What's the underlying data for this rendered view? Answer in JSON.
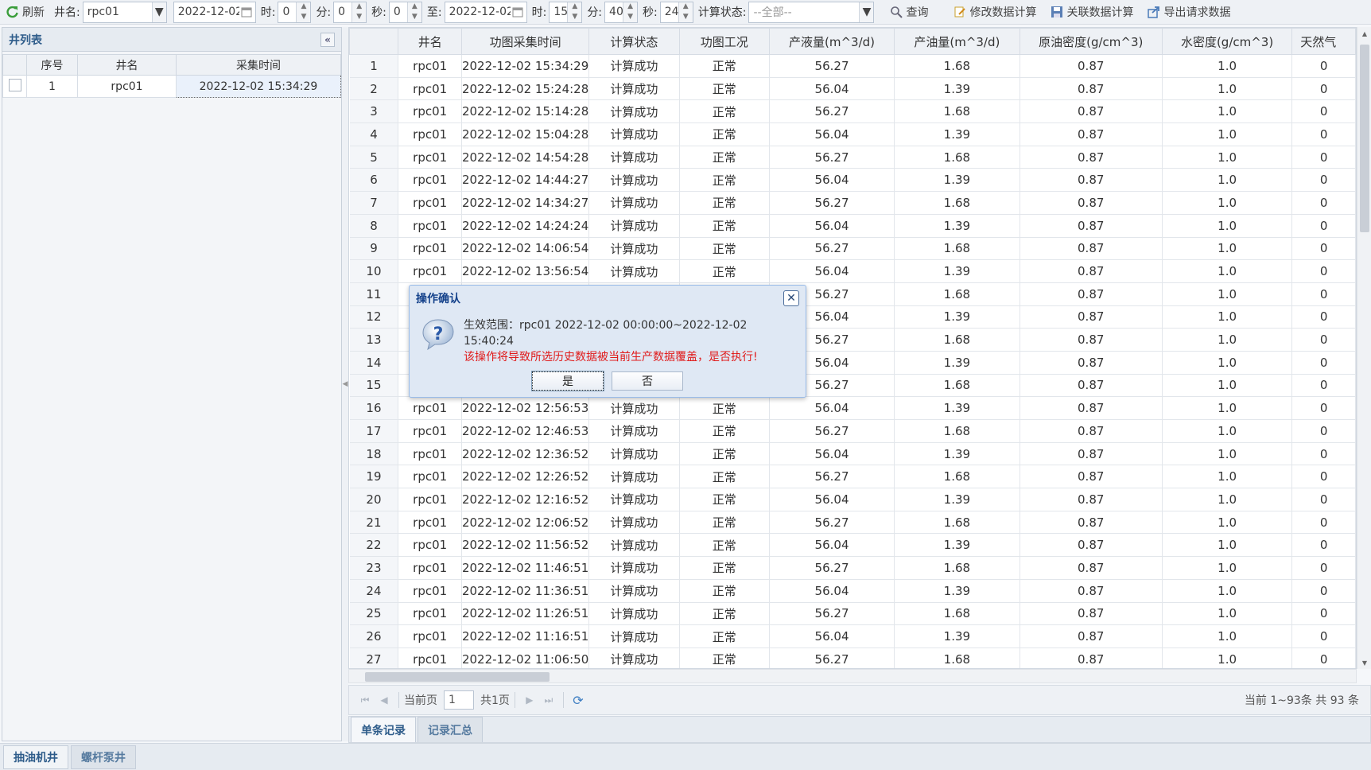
{
  "toolbar": {
    "refresh": "刷新",
    "well_label": "井名:",
    "well_value": "rpc01",
    "start_date": "2022-12-02",
    "hour_label": "时:",
    "hour_value": "0",
    "min_label": "分:",
    "min_value": "0",
    "sec_label": "秒:",
    "sec_value": "0",
    "to_label": "至:",
    "end_date": "2022-12-02",
    "end_hour_label": "时:",
    "end_hour_value": "15",
    "end_min_label": "分:",
    "end_min_value": "40",
    "end_sec_label": "秒:",
    "end_sec_value": "24",
    "status_label": "计算状态:",
    "status_value": "--全部--",
    "query": "查询",
    "modify_calc": "修改数据计算",
    "link_calc": "关联数据计算",
    "export": "导出请求数据"
  },
  "left_panel": {
    "title": "井列表",
    "columns": [
      "序号",
      "井名",
      "采集时间"
    ],
    "rows": [
      {
        "index": "1",
        "well": "rpc01",
        "time": "2022-12-02 15:34:29"
      }
    ]
  },
  "grid": {
    "columns": [
      "井名",
      "功图采集时间",
      "计算状态",
      "功图工况",
      "产液量(m^3/d)",
      "产油量(m^3/d)",
      "原油密度(g/cm^3)",
      "水密度(g/cm^3)",
      "天然气"
    ],
    "rows": [
      [
        "1",
        "rpc01",
        "2022-12-02 15:34:29",
        "计算成功",
        "正常",
        "56.27",
        "1.68",
        "0.87",
        "1.0",
        "0"
      ],
      [
        "2",
        "rpc01",
        "2022-12-02 15:24:28",
        "计算成功",
        "正常",
        "56.04",
        "1.39",
        "0.87",
        "1.0",
        "0"
      ],
      [
        "3",
        "rpc01",
        "2022-12-02 15:14:28",
        "计算成功",
        "正常",
        "56.27",
        "1.68",
        "0.87",
        "1.0",
        "0"
      ],
      [
        "4",
        "rpc01",
        "2022-12-02 15:04:28",
        "计算成功",
        "正常",
        "56.04",
        "1.39",
        "0.87",
        "1.0",
        "0"
      ],
      [
        "5",
        "rpc01",
        "2022-12-02 14:54:28",
        "计算成功",
        "正常",
        "56.27",
        "1.68",
        "0.87",
        "1.0",
        "0"
      ],
      [
        "6",
        "rpc01",
        "2022-12-02 14:44:27",
        "计算成功",
        "正常",
        "56.04",
        "1.39",
        "0.87",
        "1.0",
        "0"
      ],
      [
        "7",
        "rpc01",
        "2022-12-02 14:34:27",
        "计算成功",
        "正常",
        "56.27",
        "1.68",
        "0.87",
        "1.0",
        "0"
      ],
      [
        "8",
        "rpc01",
        "2022-12-02 14:24:24",
        "计算成功",
        "正常",
        "56.04",
        "1.39",
        "0.87",
        "1.0",
        "0"
      ],
      [
        "9",
        "rpc01",
        "2022-12-02 14:06:54",
        "计算成功",
        "正常",
        "56.27",
        "1.68",
        "0.87",
        "1.0",
        "0"
      ],
      [
        "10",
        "rpc01",
        "2022-12-02 13:56:54",
        "计算成功",
        "正常",
        "56.04",
        "1.39",
        "0.87",
        "1.0",
        "0"
      ],
      [
        "11",
        "",
        "",
        "",
        "",
        "56.27",
        "1.68",
        "0.87",
        "1.0",
        "0"
      ],
      [
        "12",
        "",
        "",
        "",
        "",
        "56.04",
        "1.39",
        "0.87",
        "1.0",
        "0"
      ],
      [
        "13",
        "",
        "",
        "",
        "",
        "56.27",
        "1.68",
        "0.87",
        "1.0",
        "0"
      ],
      [
        "14",
        "",
        "",
        "",
        "",
        "56.04",
        "1.39",
        "0.87",
        "1.0",
        "0"
      ],
      [
        "15",
        "",
        "",
        "",
        "",
        "56.27",
        "1.68",
        "0.87",
        "1.0",
        "0"
      ],
      [
        "16",
        "rpc01",
        "2022-12-02 12:56:53",
        "计算成功",
        "正常",
        "56.04",
        "1.39",
        "0.87",
        "1.0",
        "0"
      ],
      [
        "17",
        "rpc01",
        "2022-12-02 12:46:53",
        "计算成功",
        "正常",
        "56.27",
        "1.68",
        "0.87",
        "1.0",
        "0"
      ],
      [
        "18",
        "rpc01",
        "2022-12-02 12:36:52",
        "计算成功",
        "正常",
        "56.04",
        "1.39",
        "0.87",
        "1.0",
        "0"
      ],
      [
        "19",
        "rpc01",
        "2022-12-02 12:26:52",
        "计算成功",
        "正常",
        "56.27",
        "1.68",
        "0.87",
        "1.0",
        "0"
      ],
      [
        "20",
        "rpc01",
        "2022-12-02 12:16:52",
        "计算成功",
        "正常",
        "56.04",
        "1.39",
        "0.87",
        "1.0",
        "0"
      ],
      [
        "21",
        "rpc01",
        "2022-12-02 12:06:52",
        "计算成功",
        "正常",
        "56.27",
        "1.68",
        "0.87",
        "1.0",
        "0"
      ],
      [
        "22",
        "rpc01",
        "2022-12-02 11:56:52",
        "计算成功",
        "正常",
        "56.04",
        "1.39",
        "0.87",
        "1.0",
        "0"
      ],
      [
        "23",
        "rpc01",
        "2022-12-02 11:46:51",
        "计算成功",
        "正常",
        "56.27",
        "1.68",
        "0.87",
        "1.0",
        "0"
      ],
      [
        "24",
        "rpc01",
        "2022-12-02 11:36:51",
        "计算成功",
        "正常",
        "56.04",
        "1.39",
        "0.87",
        "1.0",
        "0"
      ],
      [
        "25",
        "rpc01",
        "2022-12-02 11:26:51",
        "计算成功",
        "正常",
        "56.27",
        "1.68",
        "0.87",
        "1.0",
        "0"
      ],
      [
        "26",
        "rpc01",
        "2022-12-02 11:16:51",
        "计算成功",
        "正常",
        "56.04",
        "1.39",
        "0.87",
        "1.0",
        "0"
      ],
      [
        "27",
        "rpc01",
        "2022-12-02 11:06:50",
        "计算成功",
        "正常",
        "56.27",
        "1.68",
        "0.87",
        "1.0",
        "0"
      ]
    ]
  },
  "pager": {
    "current_label": "当前页",
    "page_value": "1",
    "total_pages": "共1页",
    "info": "当前 1~93条 共 93 条"
  },
  "tabs": [
    "单条记录",
    "记录汇总"
  ],
  "bottom_tabs": [
    "抽油机井",
    "螺杆泵井"
  ],
  "dialog": {
    "title": "操作确认",
    "line1": "生效范围：rpc01 2022-12-02 00:00:00~2022-12-02 15:40:24",
    "line2": "该操作将导致所选历史数据被当前生产数据覆盖，是否执行!",
    "yes": "是",
    "no": "否"
  },
  "colors": {
    "accent": "#2e5c8a",
    "warn": "#e01b1b",
    "dialog_bg": "#dfe8f4"
  }
}
